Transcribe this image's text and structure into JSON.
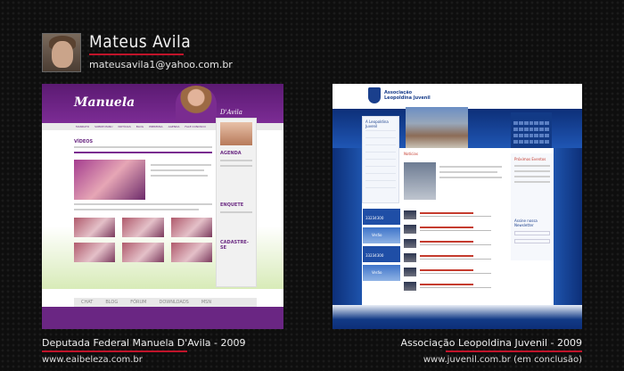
{
  "profile": {
    "name": "Mateus Avila",
    "email": "mateusavila1@yahoo.com.br"
  },
  "projects": [
    {
      "caption": "Deputada Federal Manuela D'Avila - 2009",
      "url": "www.eaibeleza.com.br",
      "mock": {
        "logo": "Manuela",
        "signature": "D'Avila",
        "nav": [
          "MANDATO",
          "SOBRE MANU",
          "NOTÍCIAS",
          "BLOG",
          "IMPRENSA",
          "AGENDA",
          "FALE CONOSCO"
        ],
        "section_title": "VÍDEOS",
        "sidebar": [
          "AGENDA",
          "ENQUETE",
          "CADASTRE-SE"
        ],
        "footer": [
          "CHAT",
          "BLOG",
          "FÓRUM",
          "DOWNLOADS",
          "MSN"
        ]
      }
    },
    {
      "caption": "Associação Leopoldina Juvenil - 2009",
      "url": "www.juvenil.com.br (em conclusão)",
      "mock": {
        "title_line1": "Associação",
        "title_line2": "Leopoldina Juvenil",
        "left_nav_heading": "A Leopoldina Juvenil",
        "section": "Notícias",
        "ads": [
          "33234300",
          "Verão",
          "33234300",
          "Verão"
        ],
        "right_heading": "Busca no site",
        "events_heading": "Próximos Eventos",
        "newsletter": "Assine nossa Newsletter"
      }
    }
  ],
  "colors": {
    "accent_red": "#c0142a",
    "purple": "#6a2683",
    "blue": "#123a86"
  }
}
